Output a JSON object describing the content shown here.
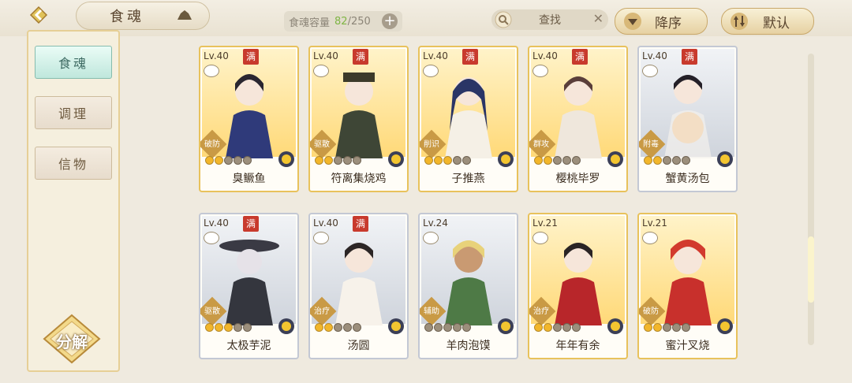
{
  "header": {
    "title": "食魂",
    "capacity_label": "食魂容量",
    "capacity_current": "82",
    "capacity_max": "/250",
    "search_placeholder": "查找",
    "sort_order_label": "降序",
    "sort_mode_label": "默认"
  },
  "sidebar": {
    "items": [
      {
        "label": "食魂",
        "active": true
      },
      {
        "label": "调理",
        "active": false
      },
      {
        "label": "信物",
        "active": false
      }
    ],
    "decompose_label": "分解"
  },
  "cards": [
    {
      "level": "Lv.40",
      "max": "满",
      "role": "破防",
      "name": "臭鳜鱼",
      "stars": 2,
      "frame": "gold"
    },
    {
      "level": "Lv.40",
      "max": "满",
      "role": "驱散",
      "name": "符离集烧鸡",
      "stars": 2,
      "frame": "gold"
    },
    {
      "level": "Lv.40",
      "max": "满",
      "role": "削识",
      "name": "子推燕",
      "stars": 3,
      "frame": "gold"
    },
    {
      "level": "Lv.40",
      "max": "满",
      "role": "群攻",
      "name": "樱桃毕罗",
      "stars": 2,
      "frame": "gold"
    },
    {
      "level": "Lv.40",
      "max": "满",
      "role": "附毒",
      "name": "蟹黄汤包",
      "stars": 2,
      "frame": "silver"
    },
    {
      "level": "Lv.40",
      "max": "满",
      "role": "驱散",
      "name": "太极芋泥",
      "stars": 3,
      "frame": "silver"
    },
    {
      "level": "Lv.40",
      "max": "满",
      "role": "治疗",
      "name": "汤圆",
      "stars": 2,
      "frame": "silver"
    },
    {
      "level": "Lv.24",
      "max": "",
      "role": "辅助",
      "name": "羊肉泡馍",
      "stars": 0,
      "frame": "silver"
    },
    {
      "level": "Lv.21",
      "max": "",
      "role": "治疗",
      "name": "年年有余",
      "stars": 2,
      "frame": "gold"
    },
    {
      "level": "Lv.21",
      "max": "",
      "role": "破防",
      "name": "蜜汁叉烧",
      "stars": 2,
      "frame": "gold"
    }
  ],
  "colors": {
    "capacity_current": "#7fb544",
    "max_badge": "#c83a2d",
    "gold_frame": "#e8c25c",
    "silver_frame": "#c3c8d4"
  }
}
